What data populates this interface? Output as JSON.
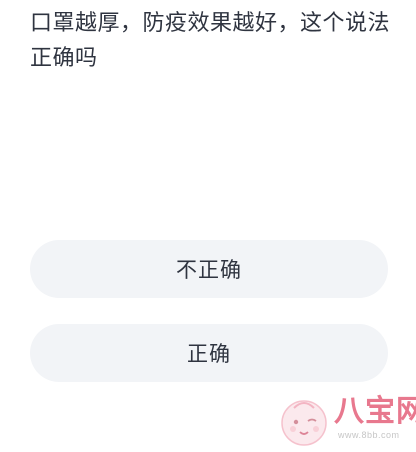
{
  "question": {
    "text": "口罩越厚，防疫效果越好，这个说法正确吗"
  },
  "options": [
    {
      "label": "不正确"
    },
    {
      "label": "正确"
    }
  ],
  "watermark": {
    "title": "八宝网",
    "url": "www.8bb.com"
  },
  "colors": {
    "text": "#2f3440",
    "option_bg": "#f2f4f7",
    "watermark_accent": "#e2536f"
  }
}
